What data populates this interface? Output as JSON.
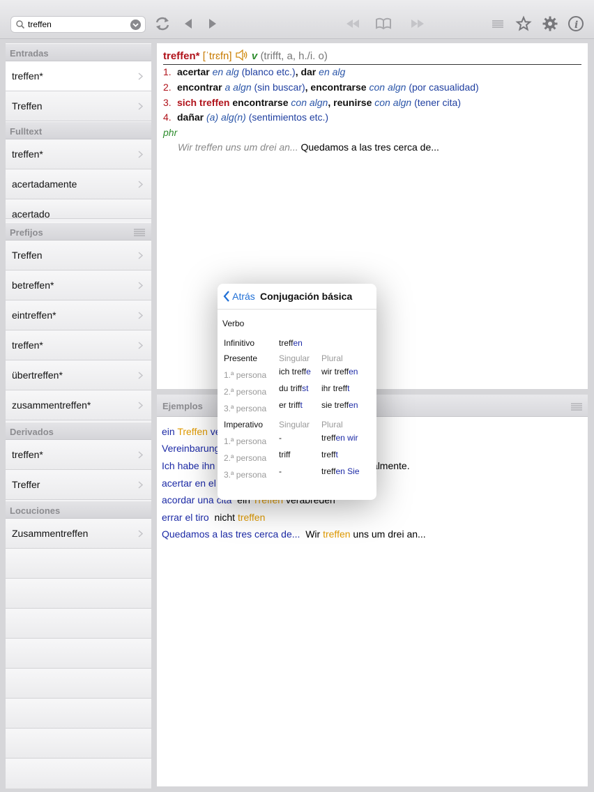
{
  "toolbar": {
    "search_value": "treffen"
  },
  "sidebar": {
    "sections": [
      {
        "title": "Entradas",
        "items": [
          "treffen*",
          "Treffen"
        ]
      },
      {
        "title": "Fulltext",
        "items": [
          "treffen*",
          "acertadamente",
          "acertado"
        ]
      },
      {
        "title": "Prefijos",
        "items": [
          "Treffen",
          "betreffen*",
          "eintreffen*",
          "treffen*",
          "übertreffen*",
          "zusammentreffen*"
        ]
      },
      {
        "title": "Derivados",
        "items": [
          "treffen*",
          "Treffer"
        ]
      },
      {
        "title": "Locuciones",
        "items": [
          "Zusammentreffen"
        ]
      }
    ]
  },
  "entry": {
    "headword": "treffen*",
    "pronunciation": "[ˈtrɛfn]",
    "pos": "v",
    "grammar": "(trifft, a, h./i. o)",
    "defs": [
      {
        "num": "1.",
        "parts": [
          [
            "b",
            "acertar"
          ],
          [
            "t",
            " "
          ],
          [
            "i",
            "en alg"
          ],
          [
            "t",
            " "
          ],
          [
            "g",
            "(blanco etc.)"
          ],
          [
            "b",
            ", dar"
          ],
          [
            "t",
            " "
          ],
          [
            "i",
            "en alg"
          ]
        ]
      },
      {
        "num": "2.",
        "parts": [
          [
            "b",
            "encontrar"
          ],
          [
            "t",
            " "
          ],
          [
            "i",
            "a algn"
          ],
          [
            "t",
            " "
          ],
          [
            "g",
            "(sin buscar)"
          ],
          [
            "b",
            ", encontrarse"
          ],
          [
            "t",
            " "
          ],
          [
            "i",
            "con algn"
          ],
          [
            "t",
            " "
          ],
          [
            "g",
            "(por casualidad)"
          ]
        ]
      },
      {
        "num": "3.",
        "parts": [
          [
            "k",
            "sich treffen"
          ],
          [
            "t",
            " "
          ],
          [
            "b",
            "encontrarse"
          ],
          [
            "t",
            " "
          ],
          [
            "i",
            "con algn"
          ],
          [
            "b",
            ", reunirse"
          ],
          [
            "t",
            " "
          ],
          [
            "i",
            "con algn"
          ],
          [
            "t",
            " "
          ],
          [
            "g",
            "(tener cita)"
          ]
        ]
      },
      {
        "num": "4.",
        "parts": [
          [
            "b",
            "dañar"
          ],
          [
            "t",
            " "
          ],
          [
            "i",
            "(a) alg(n)"
          ],
          [
            "t",
            " "
          ],
          [
            "g",
            "(sentimientos etc.)"
          ]
        ]
      }
    ],
    "phr_label": "phr",
    "phr_de": "Wir treffen uns um drei an...",
    "phr_es": "Quedamos a las tres cerca de..."
  },
  "ejemplos": {
    "title": "Ejemplos",
    "lines": [
      [
        [
          "es",
          "ein "
        ],
        [
          "hl",
          "Treffen"
        ],
        [
          "es",
          " ve"
        ]
      ],
      [
        [
          "es",
          "Vereinbarung"
        ]
      ],
      [
        [
          "es",
          "Ich habe ihn"
        ],
        [
          "t",
          "                                                 ersonalmente."
        ]
      ],
      [
        [
          "es",
          "acertar en el"
        ]
      ],
      [
        [
          "es",
          "acordar una cita"
        ],
        [
          "t",
          "  ein "
        ],
        [
          "hl",
          "Treffen"
        ],
        [
          "t",
          " verabreden"
        ]
      ],
      [
        [
          "es",
          "errar el tiro"
        ],
        [
          "t",
          "  nicht "
        ],
        [
          "hl",
          "treffen"
        ]
      ],
      [
        [
          "es",
          "Quedamos a las tres cerca de..."
        ],
        [
          "t",
          "  Wir "
        ],
        [
          "hl",
          "treffen"
        ],
        [
          "t",
          " uns um drei an..."
        ]
      ]
    ]
  },
  "popup": {
    "back": "Atrás",
    "title": "Conjugación básica",
    "verbo": "Verbo",
    "infinitivo_label": "Infinitivo",
    "infinitivo": [
      "treff",
      "en"
    ],
    "presente_label": "Presente",
    "singular": "Singular",
    "plural": "Plural",
    "persona": [
      "1.ª persona",
      "2.ª persona",
      "3.ª persona"
    ],
    "presente": [
      [
        [
          "ich treff",
          "e"
        ],
        [
          "wir treff",
          "en"
        ]
      ],
      [
        [
          "du triff",
          "st"
        ],
        [
          "ihr treff",
          "t"
        ]
      ],
      [
        [
          "er triff",
          "t"
        ],
        [
          "sie treff",
          "en"
        ]
      ]
    ],
    "imperativo_label": "Imperativo",
    "imperativo": [
      [
        [
          "-",
          ""
        ],
        [
          "treff",
          "en wir"
        ]
      ],
      [
        [
          "triff",
          ""
        ],
        [
          "treff",
          "t"
        ]
      ],
      [
        [
          "-",
          ""
        ],
        [
          "treff",
          "en Sie"
        ]
      ]
    ]
  },
  "colors": {
    "accent_red": "#b0121a",
    "link_blue": "#1c2aa6",
    "highlight": "#e09a00",
    "ios_blue": "#1f6fd6"
  }
}
